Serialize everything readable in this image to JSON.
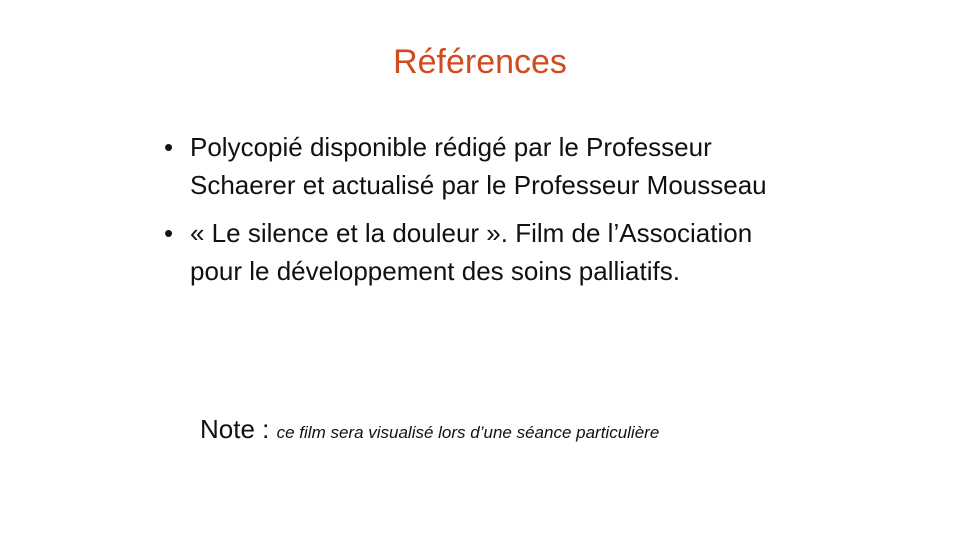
{
  "slide": {
    "title": "Références",
    "bullets": [
      "Polycopié disponible rédigé par le Professeur Schaerer et actualisé par le Professeur Mousseau",
      "« Le silence et la douleur ». Film de l’Association pour le développement des soins palliatifs."
    ],
    "note_label": "Note :",
    "note_text": "ce film sera visualisé lors d’une séance particulière",
    "colors": {
      "title": "#d24a1e",
      "text": "#111111",
      "background": "#ffffff"
    }
  }
}
